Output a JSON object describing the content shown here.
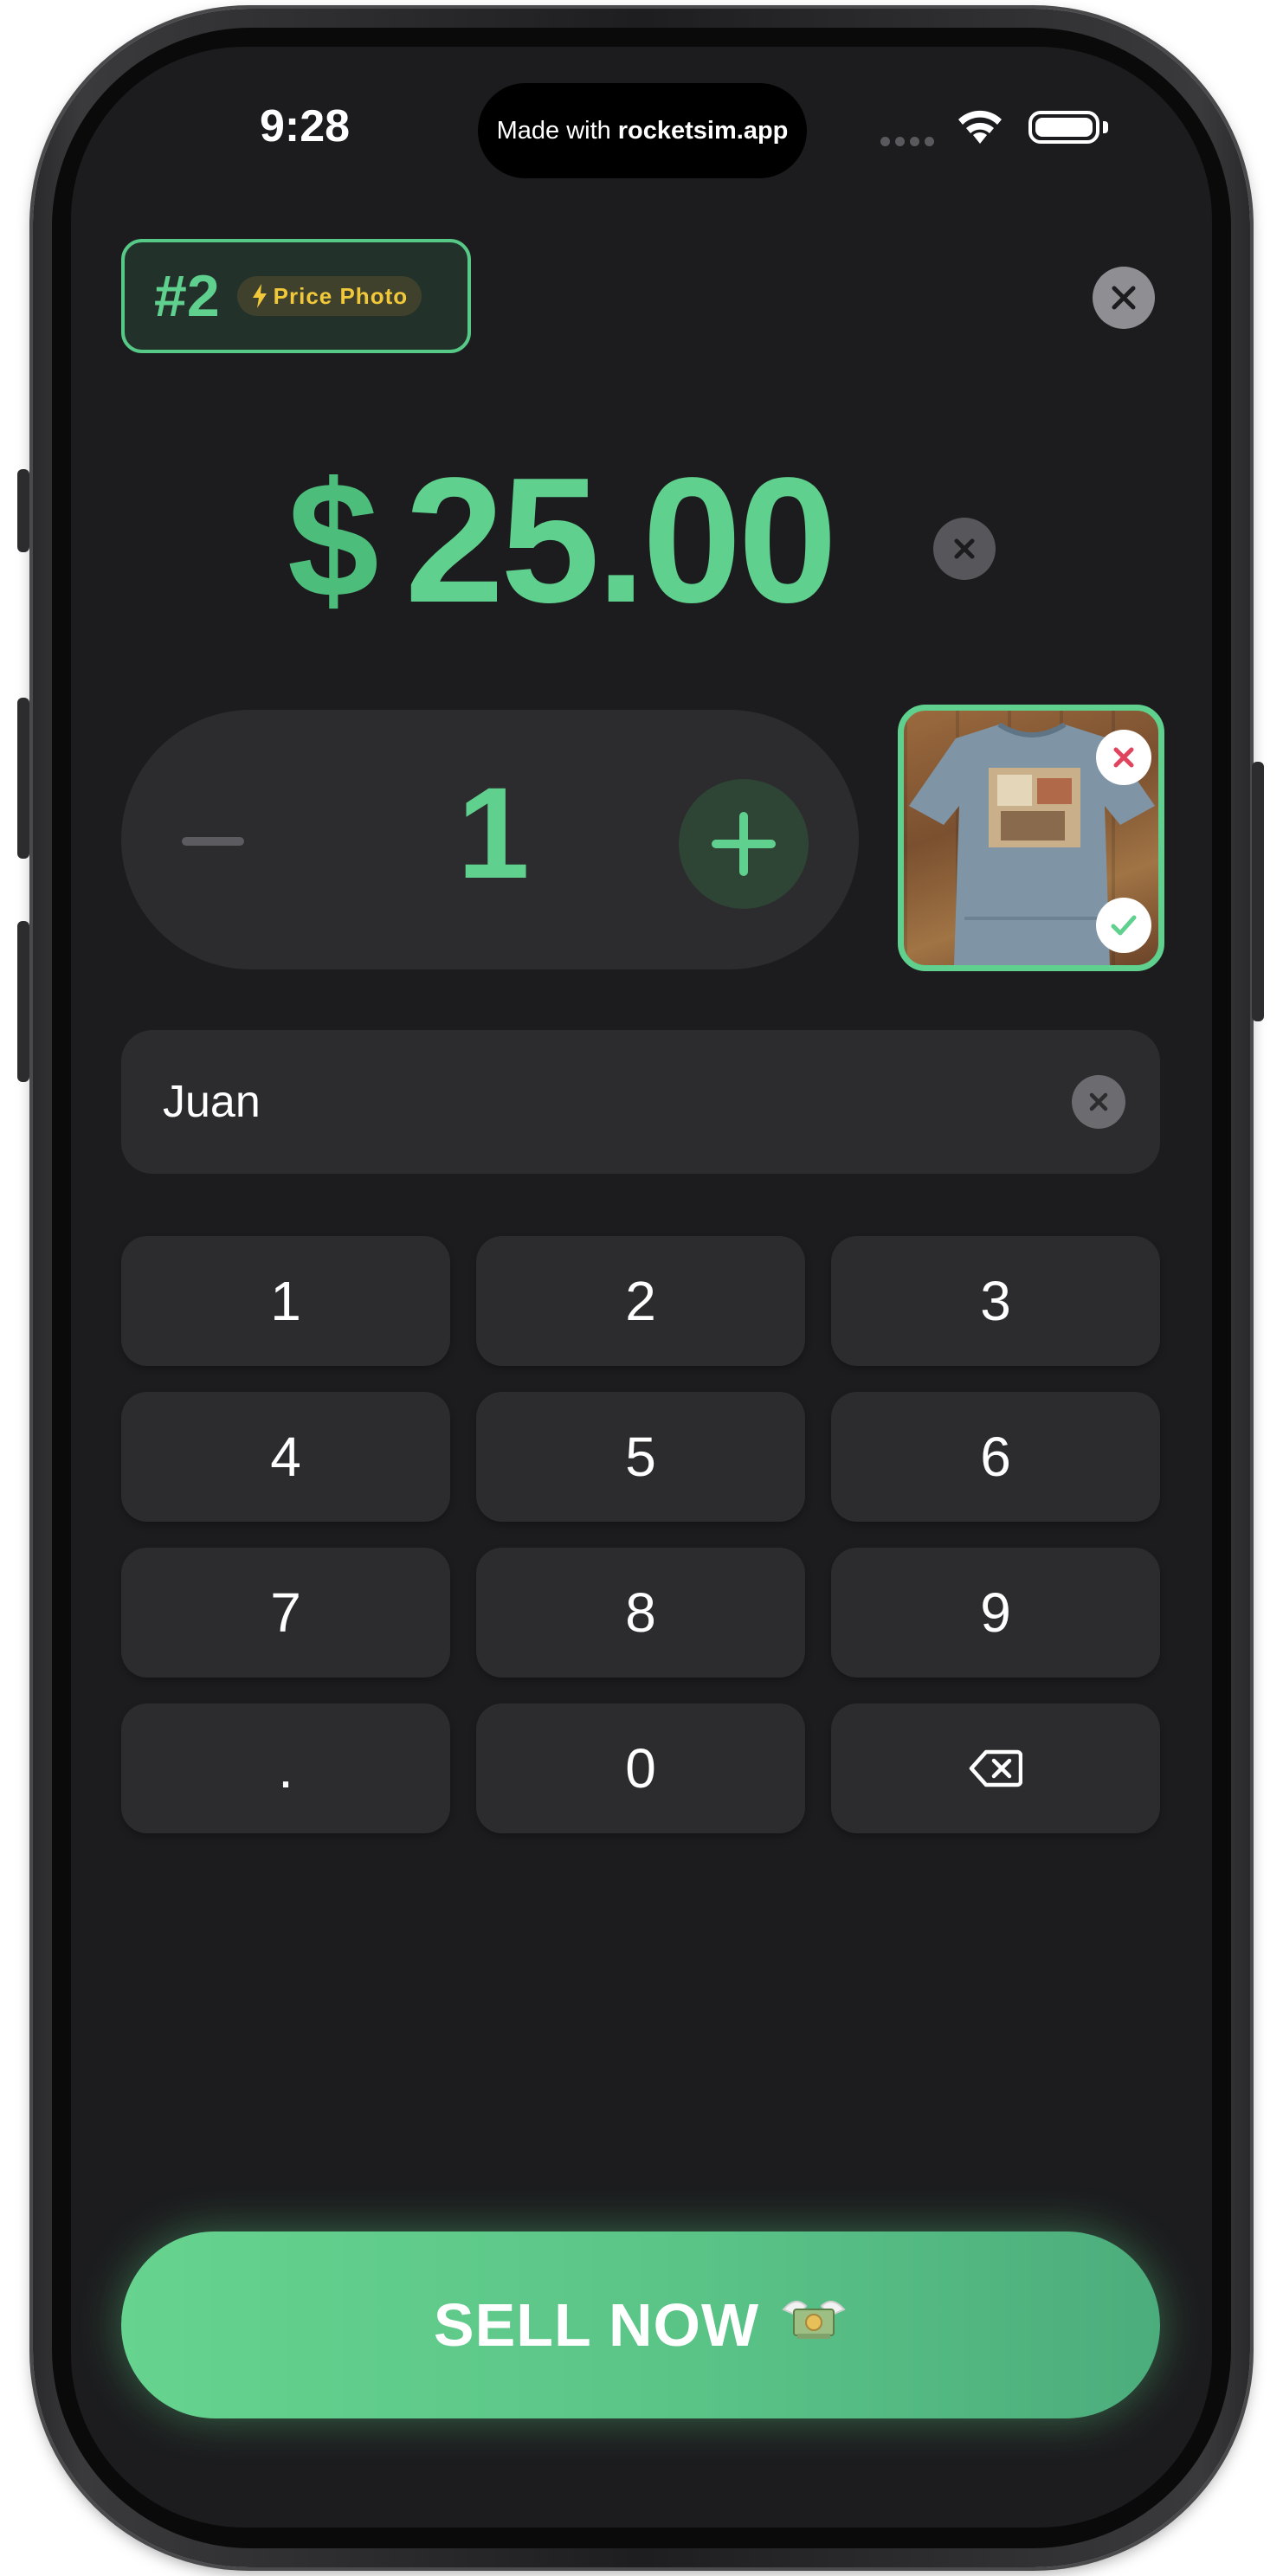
{
  "status": {
    "time": "9:28",
    "island_text": "Made with",
    "island_brand": "rocketsim.app"
  },
  "header": {
    "item_number": "#2",
    "mode_badge": "Price  Photo"
  },
  "price": {
    "currency_symbol": "$",
    "amount": "25.00"
  },
  "quantity": {
    "value": "1"
  },
  "customer": {
    "name": "Juan"
  },
  "keypad": {
    "keys": [
      "1",
      "2",
      "3",
      "4",
      "5",
      "6",
      "7",
      "8",
      "9",
      ".",
      "0"
    ]
  },
  "sell_button": {
    "label": "SELL NOW",
    "emoji": "💸"
  },
  "colors": {
    "accent_green": "#5fd08d",
    "background": "#1c1c1e",
    "key_bg": "#2c2c2e",
    "badge_yellow": "#f0c83a",
    "reject_red": "#e0455d"
  }
}
